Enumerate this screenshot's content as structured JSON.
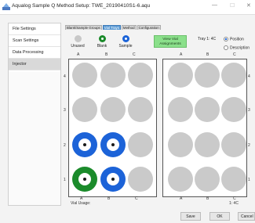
{
  "window": {
    "title": "Aqualog Sample Q Method Setup: TWE_20190410S1-6.aqu",
    "min": "—",
    "max": "☐",
    "close": "✕"
  },
  "nav": {
    "items": [
      {
        "label": "File Settings",
        "selected": false
      },
      {
        "label": "Scan Settings",
        "selected": false
      },
      {
        "label": "Data Processing",
        "selected": false
      },
      {
        "label": "Injector",
        "selected": true
      }
    ]
  },
  "tabs": [
    {
      "label": "Blank/Sample Groups",
      "active": false
    },
    {
      "label": "Vial Trays",
      "active": true
    },
    {
      "label": "Method",
      "active": false
    },
    {
      "label": "Configuration",
      "active": false
    }
  ],
  "legend": {
    "unused": "Unused",
    "blank": "Blank",
    "sample": "Sample"
  },
  "assign_button": {
    "line1": "View Vial",
    "line2": "Assignments"
  },
  "tray_info": {
    "label": "Tray 1: 4C",
    "position": "Position",
    "description": "Description"
  },
  "trays": {
    "left": {
      "columns": [
        "A",
        "B",
        "C"
      ],
      "rows": [
        "4",
        "3",
        "2",
        "1"
      ],
      "wells": {
        "4": [
          "unused",
          "unused",
          "unused"
        ],
        "3": [
          "unused",
          "unused",
          "unused"
        ],
        "2": [
          "sample",
          "sample",
          "unused"
        ],
        "1": [
          "blank",
          "sample",
          "unused"
        ]
      },
      "usage_label": "Vial Usage:"
    },
    "right": {
      "columns": [
        "A",
        "B",
        "C"
      ],
      "rows": [
        "4",
        "3",
        "2",
        "1"
      ],
      "footer": "1: 4C"
    }
  },
  "buttons": {
    "save": "Save",
    "ok": "OK",
    "cancel": "Cancel"
  },
  "colors": {
    "blank": "#1b8b2b",
    "sample": "#1c63d8",
    "unused": "#c6c6c6",
    "assign": "#8be08b"
  }
}
